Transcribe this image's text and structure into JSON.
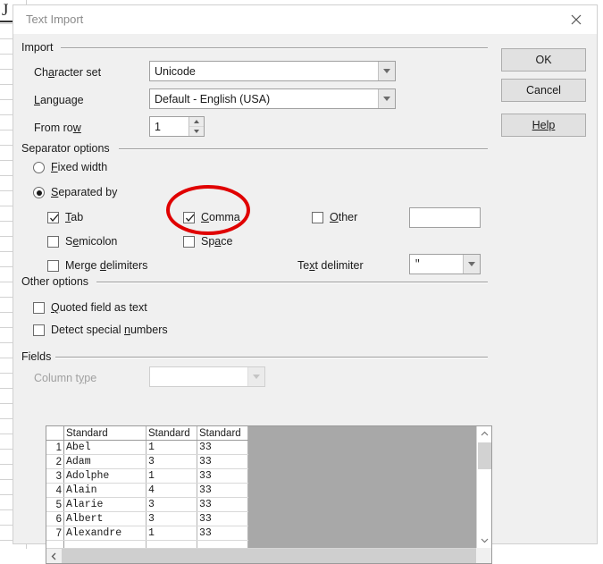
{
  "background": {
    "corner_glyph": "J"
  },
  "dialog": {
    "title": "Text Import",
    "close_icon": "close-icon",
    "buttons": {
      "ok": "OK",
      "cancel": "Cancel",
      "help": "Help"
    },
    "import_group": {
      "legend": "Import",
      "character_set": {
        "label": "Character set",
        "value": "Unicode"
      },
      "language": {
        "label": "Language",
        "value": "Default - English (USA)"
      },
      "from_row": {
        "label": "From row",
        "value": "1"
      }
    },
    "separator_group": {
      "legend": "Separator options",
      "fixed_width": {
        "label": "Fixed width",
        "checked": false
      },
      "separated_by": {
        "label": "Separated by",
        "checked": true
      },
      "tab": {
        "label": "Tab",
        "checked": true
      },
      "semicolon": {
        "label": "Semicolon",
        "checked": false
      },
      "merge_delimiters": {
        "label": "Merge delimiters",
        "checked": false
      },
      "comma": {
        "label": "Comma",
        "checked": true
      },
      "space": {
        "label": "Space",
        "checked": false
      },
      "other": {
        "label": "Other",
        "checked": false,
        "value": ""
      },
      "text_delimiter": {
        "label": "Text delimiter",
        "value": "\""
      }
    },
    "other_group": {
      "legend": "Other options",
      "quoted_field_as_text": {
        "label": "Quoted field as text",
        "checked": false
      },
      "detect_special_numbers": {
        "label": "Detect special numbers",
        "checked": false
      }
    },
    "fields_group": {
      "legend": "Fields",
      "column_type": {
        "label": "Column type",
        "value": "",
        "disabled": true
      },
      "preview": {
        "headers": [
          "Standard",
          "Standard",
          "Standard"
        ],
        "rows": [
          {
            "n": "1",
            "cells": [
              "Abel",
              "1",
              "33"
            ]
          },
          {
            "n": "2",
            "cells": [
              "Adam",
              "3",
              "33"
            ]
          },
          {
            "n": "3",
            "cells": [
              "Adolphe",
              "1",
              "33"
            ]
          },
          {
            "n": "4",
            "cells": [
              "Alain",
              "4",
              "33"
            ]
          },
          {
            "n": "5",
            "cells": [
              "Alarie",
              "3",
              "33"
            ]
          },
          {
            "n": "6",
            "cells": [
              "Albert",
              "3",
              "33"
            ]
          },
          {
            "n": "7",
            "cells": [
              "Alexandre",
              "1",
              "33"
            ]
          }
        ]
      }
    }
  },
  "annotation": {
    "shape": "ellipse",
    "color": "#e00000",
    "targets": "comma-checkbox"
  }
}
